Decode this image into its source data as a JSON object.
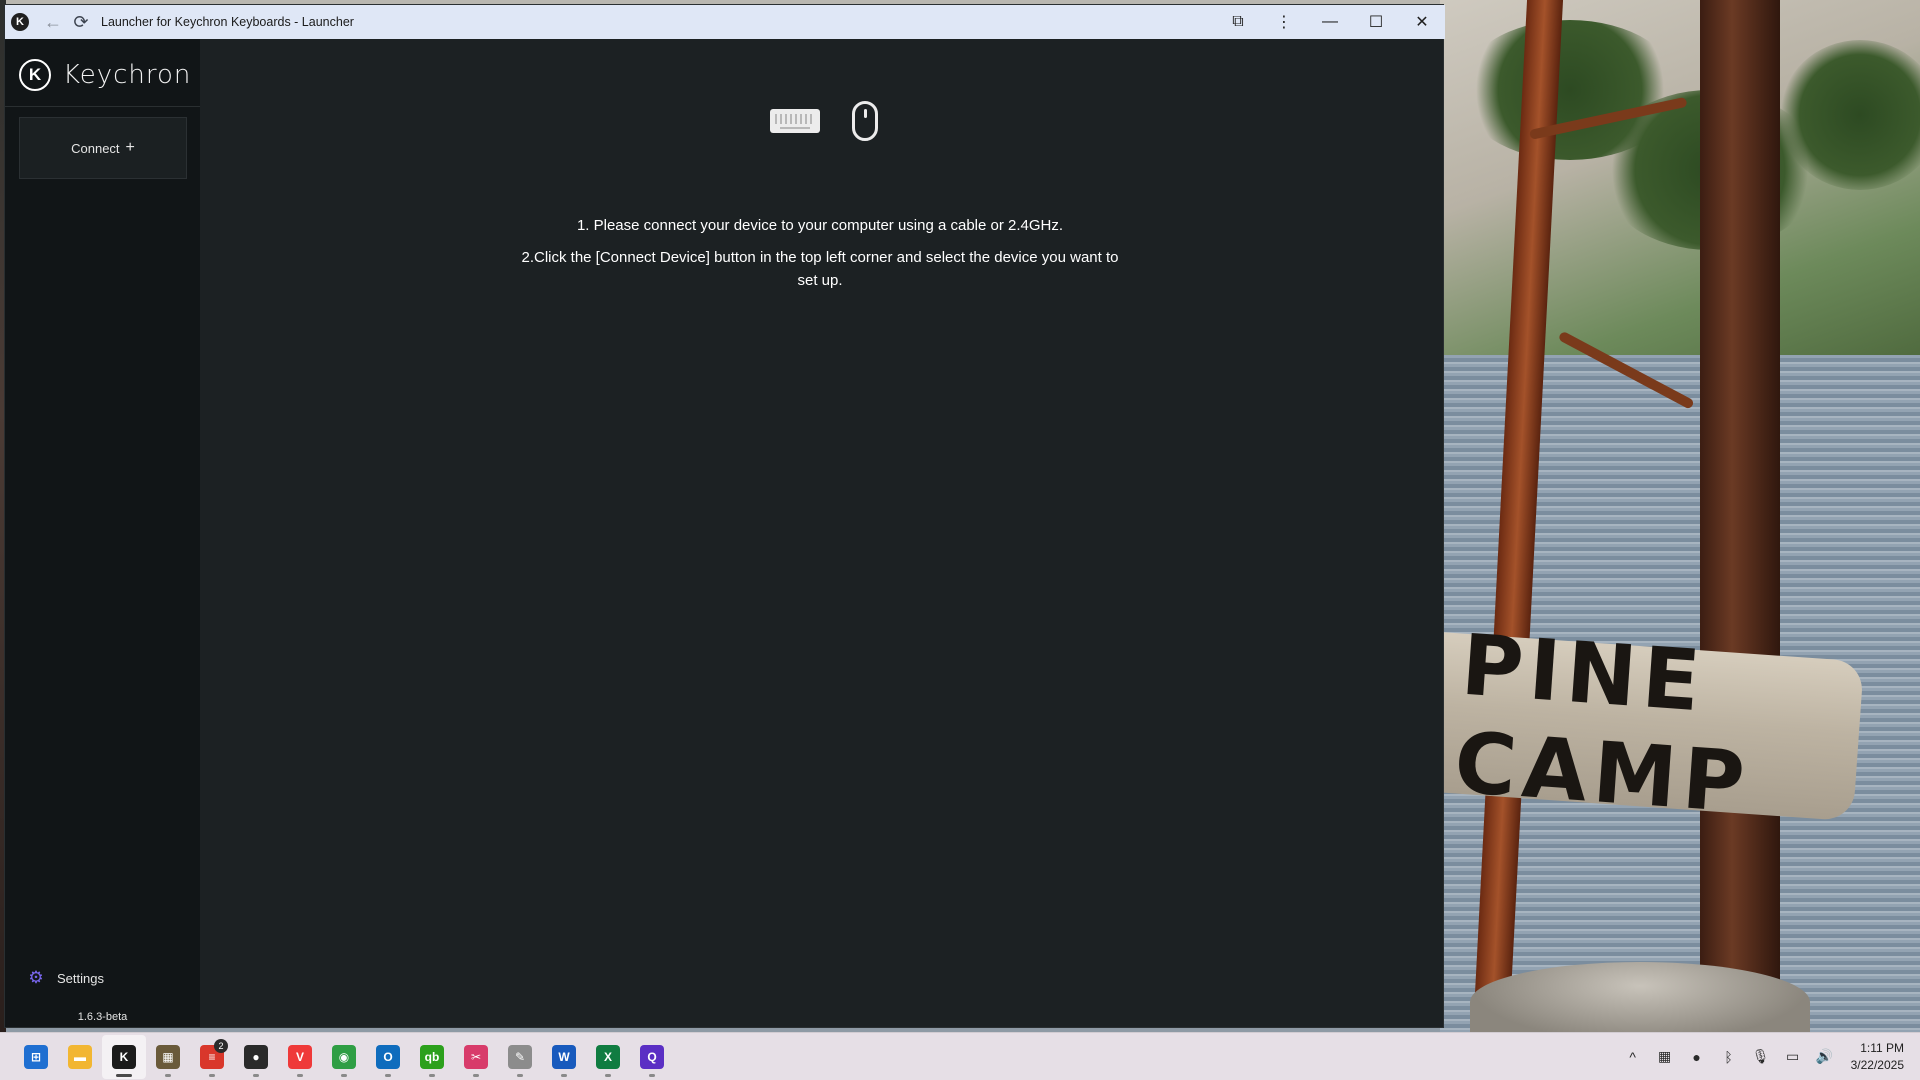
{
  "window": {
    "title": "Launcher for Keychron Keyboards - Launcher"
  },
  "sidebar": {
    "brand": "Keychron",
    "connect_label": "Connect",
    "settings_label": "Settings",
    "version": "1.6.3-beta"
  },
  "main": {
    "instruction_1": "1. Please connect your device to your computer using a cable or 2.4GHz.",
    "instruction_2": "2.Click the [Connect Device] button in the top left corner and select the device you want to set up."
  },
  "wallpaper": {
    "sign_text": "PINE CAMP"
  },
  "taskbar": {
    "apps": [
      {
        "name": "windows-start-icon",
        "color": "#1f6fd1",
        "glyph": "⊞"
      },
      {
        "name": "file-explorer-icon",
        "color": "#f2b632",
        "glyph": "▬"
      },
      {
        "name": "keychron-launcher-icon",
        "color": "#1b1b1b",
        "glyph": "K",
        "active": true
      },
      {
        "name": "notes-app-icon",
        "color": "#6a5a3a",
        "glyph": "▦"
      },
      {
        "name": "stack-app-icon",
        "color": "#d9372b",
        "glyph": "≡",
        "badge": "2"
      },
      {
        "name": "red-circle-app-icon",
        "color": "#2a2a2a",
        "glyph": "●"
      },
      {
        "name": "vivaldi-icon",
        "color": "#ef3939",
        "glyph": "V"
      },
      {
        "name": "chrome-icon",
        "color": "#2f9e44",
        "glyph": "◉"
      },
      {
        "name": "outlook-icon",
        "color": "#0f6cbd",
        "glyph": "O"
      },
      {
        "name": "quickbooks-icon",
        "color": "#2ca01c",
        "glyph": "qb"
      },
      {
        "name": "snipping-tool-icon",
        "color": "#d83b6a",
        "glyph": "✂"
      },
      {
        "name": "tool-app-icon",
        "color": "#8c8c8c",
        "glyph": "✎"
      },
      {
        "name": "word-icon",
        "color": "#185abd",
        "glyph": "W"
      },
      {
        "name": "excel-icon",
        "color": "#107c41",
        "glyph": "X"
      },
      {
        "name": "purple-app-icon",
        "color": "#5b2fc4",
        "glyph": "Q"
      }
    ],
    "tray": [
      {
        "name": "show-hidden-icons-icon",
        "glyph": "^"
      },
      {
        "name": "tray-app-icon",
        "glyph": "▦"
      },
      {
        "name": "color-app-icon",
        "glyph": "●"
      },
      {
        "name": "bluetooth-icon",
        "glyph": "ᛒ"
      },
      {
        "name": "microphone-icon",
        "glyph": "🎙"
      },
      {
        "name": "network-icon",
        "glyph": "▭"
      },
      {
        "name": "volume-icon",
        "glyph": "🔊"
      }
    ],
    "time": "1:11 PM",
    "date": "3/22/2025"
  }
}
